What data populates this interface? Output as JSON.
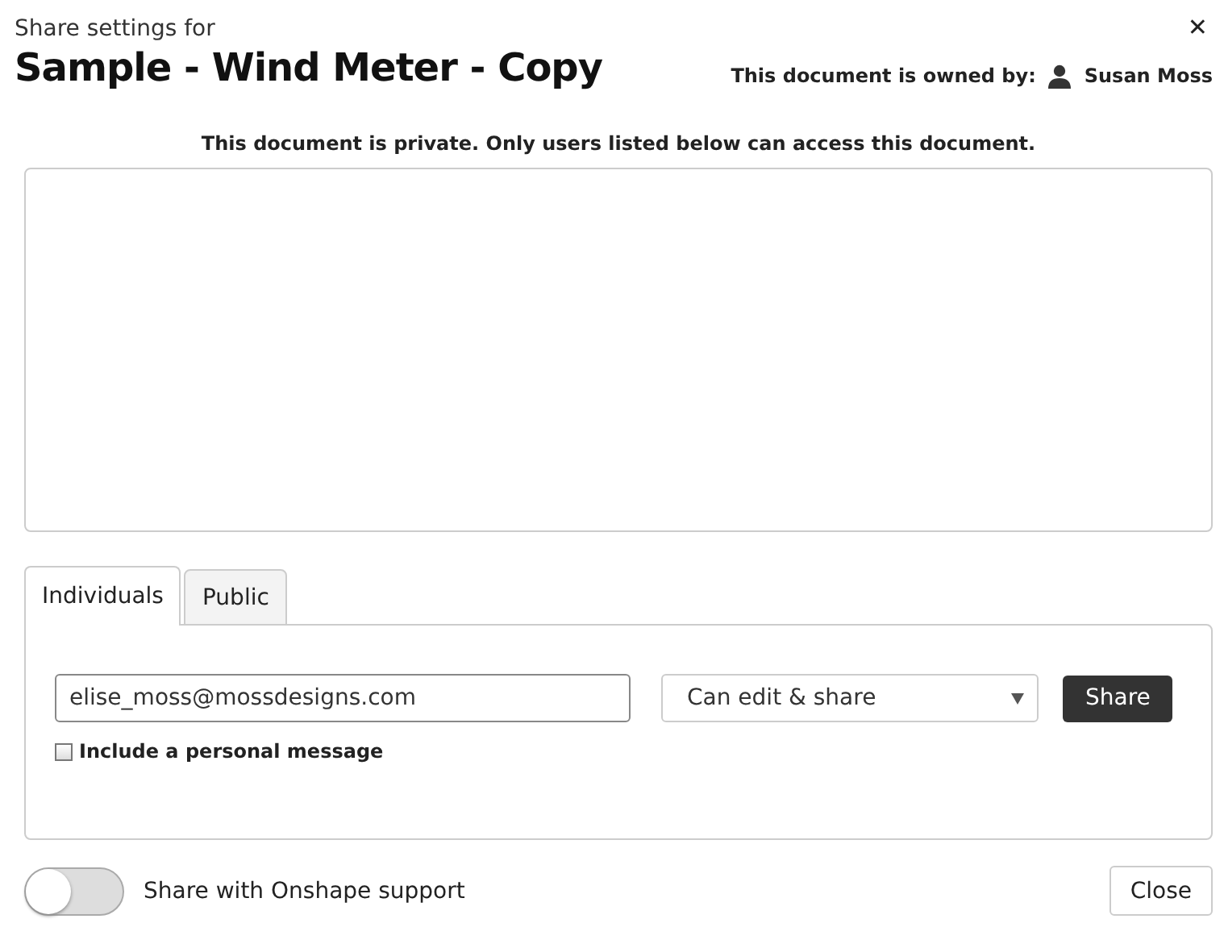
{
  "header": {
    "subtitle": "Share settings for",
    "title": "Sample - Wind Meter - Copy",
    "close_icon": "✕",
    "owner_label": "This document is owned by:",
    "owner_name": "Susan Moss"
  },
  "privacy_notice": "This document is private. Only users listed below can access this document.",
  "tabs": [
    {
      "label": "Individuals",
      "selected": true
    },
    {
      "label": "Public",
      "selected": false
    }
  ],
  "invite": {
    "email": {
      "value": "elise_moss@mossdesigns.com"
    },
    "permission": {
      "value": "Can edit & share"
    },
    "share_button": "Share",
    "personal_message": {
      "label": "Include a personal message",
      "checked": false
    }
  },
  "footer": {
    "support_toggle": {
      "label": "Share with Onshape support",
      "on": false
    },
    "close_button": "Close"
  }
}
